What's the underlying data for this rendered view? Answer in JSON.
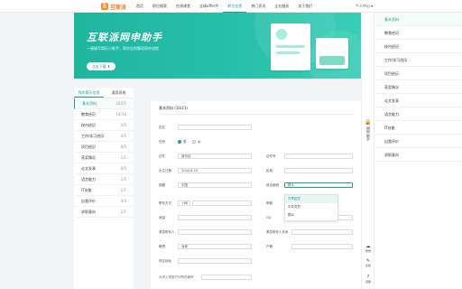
{
  "header": {
    "logo_mark": "互",
    "logo_text": "互联派",
    "nav": [
      "首页",
      "职位搜索",
      "在线课堂",
      "全球offer节",
      "职位信息",
      "热门资讯",
      "企业服务",
      "关于我们"
    ],
    "user": "个人中心 ▾"
  },
  "banner": {
    "title": "互联派网申助手",
    "subtitle": "一键填写简历小助手，帮你告别繁琐网申流程",
    "button": "点击下载 ⬇"
  },
  "sidebar": {
    "tabs": [
      "我的简历信息",
      "通用表格"
    ],
    "items": [
      {
        "label": "基本资料",
        "count": "10/21"
      },
      {
        "label": "教育经历",
        "count": "14/16"
      },
      {
        "label": "校内经历",
        "count": "5/5"
      },
      {
        "label": "工作/实习经历",
        "count": "0/5"
      },
      {
        "label": "项目经历",
        "count": "0/5"
      },
      {
        "label": "获奖情况",
        "count": "1/1"
      },
      {
        "label": "论文发表",
        "count": "0/5"
      },
      {
        "label": "语言能力",
        "count": "1/5"
      },
      {
        "label": "IT技能",
        "count": "1/1"
      },
      {
        "label": "自我评价",
        "count": "4/4"
      },
      {
        "label": "求职意向",
        "count": "1/1"
      }
    ]
  },
  "form": {
    "title": "基本资料 (10/21)",
    "name_label": "姓名",
    "gender_label": "性别",
    "gender_options": [
      "男",
      "女"
    ],
    "id_type_label": "证件",
    "id_type_value": "身份证",
    "id_no_label": "证件号",
    "birth_label": "出生日期",
    "birth_value": "2004-6-20",
    "ethnic_label": "民族",
    "country_label": "国籍",
    "country_value": "中国",
    "political_label": "政治面貌",
    "political_value": "群众",
    "contact_label": "联系方式",
    "phone_prefix": "+86",
    "email_label": "邮箱",
    "height_label": "身高",
    "qq_label": "QQ",
    "emergency_name_label": "紧急联系人",
    "emergency_rel_label": "紧急联系人关系",
    "origin_label": "籍贯",
    "origin_value": "深圳",
    "household_label": "户籍",
    "address_label": "现住地址",
    "dorm_label": "大学入学前户口所在城市"
  },
  "dropdown": [
    "共青团员",
    "中共党员",
    "群众"
  ],
  "toolbar": {
    "assistant": "网申助手",
    "login": "登录",
    "feedback": "反馈",
    "top": "顶部"
  },
  "rpanel": [
    "基本资料",
    "教育经历",
    "校内经历",
    "工作/实习经历",
    "项目经历",
    "获奖情况",
    "论文发表",
    "语言能力",
    "IT技能",
    "自我评价",
    "求职意向"
  ],
  "colors": {
    "accent": "#1aa38e",
    "banner": "#26bfa8",
    "logo": "#f47b20"
  }
}
